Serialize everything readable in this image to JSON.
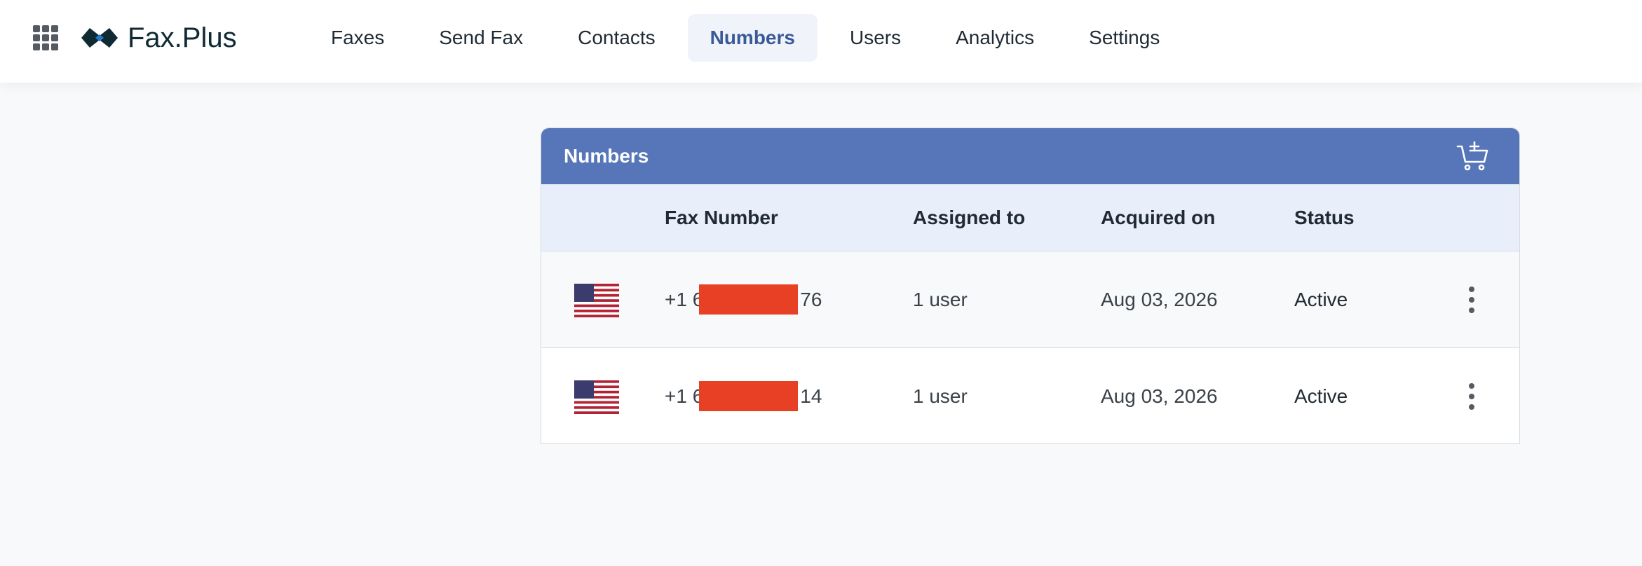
{
  "app": {
    "logo_text": "Fax.Plus"
  },
  "nav": {
    "items": [
      {
        "label": "Faxes",
        "active": false
      },
      {
        "label": "Send Fax",
        "active": false
      },
      {
        "label": "Contacts",
        "active": false
      },
      {
        "label": "Numbers",
        "active": true
      },
      {
        "label": "Users",
        "active": false
      },
      {
        "label": "Analytics",
        "active": false
      },
      {
        "label": "Settings",
        "active": false
      }
    ]
  },
  "card": {
    "title": "Numbers",
    "cart_icon": "cart-plus-icon",
    "header_color": "#5676b9"
  },
  "table": {
    "columns": [
      "Fax Number",
      "Assigned to",
      "Acquired on",
      "Status"
    ],
    "rows": [
      {
        "flag": "us-flag-icon",
        "number_prefix": "+1 6",
        "number_suffix": "76",
        "assigned": "1 user",
        "acquired": "Aug 03, 2026",
        "status": "Active"
      },
      {
        "flag": "us-flag-icon",
        "number_prefix": "+1 6",
        "number_suffix": "14",
        "assigned": "1 user",
        "acquired": "Aug 03, 2026",
        "status": "Active"
      }
    ]
  },
  "colors": {
    "accent": "#3a5a97",
    "redaction": "#e84025"
  }
}
